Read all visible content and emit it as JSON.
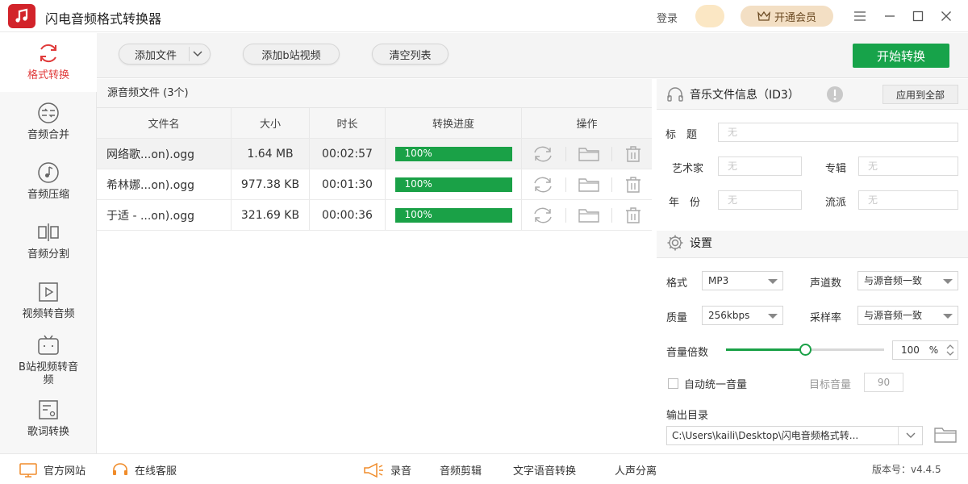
{
  "app": {
    "title": "闪电音频格式转换器",
    "login": "登录",
    "vip": "开通会员",
    "brand_color": "#d2232a",
    "accent_green": "#17a34a"
  },
  "sidebar": {
    "items": [
      {
        "label": "格式转换",
        "icon": "refresh-cycle-icon",
        "active": true
      },
      {
        "label": "音频合并",
        "icon": "merge-arrows-icon"
      },
      {
        "label": "音频压缩",
        "icon": "music-note-icon"
      },
      {
        "label": "音频分割",
        "icon": "split-icon"
      },
      {
        "label": "视频转音频",
        "icon": "video-play-icon"
      },
      {
        "label": "B站视频转音频",
        "icon": "bilibili-icon"
      },
      {
        "label": "歌词转换",
        "icon": "lyrics-file-icon"
      }
    ]
  },
  "toolbar": {
    "add_file": "添加文件",
    "add_bilibili": "添加b站视频",
    "clear_list": "清空列表",
    "start": "开始转换"
  },
  "files": {
    "header": "源音频文件 (3个)",
    "columns": [
      "文件名",
      "大小",
      "时长",
      "转换进度",
      "操作"
    ],
    "rows": [
      {
        "name": "网络歌...on).ogg",
        "size": "1.64 MB",
        "duration": "00:02:57",
        "progress": "100%",
        "progress_value": 1.0
      },
      {
        "name": "希林娜...on).ogg",
        "size": "977.38 KB",
        "duration": "00:01:30",
        "progress": "100%",
        "progress_value": 1.0
      },
      {
        "name": "于适 - ...on).ogg",
        "size": "321.69 KB",
        "duration": "00:00:36",
        "progress": "100%",
        "progress_value": 1.0
      }
    ]
  },
  "id3": {
    "title": "音乐文件信息（ID3）",
    "apply_all": "应用到全部",
    "fields": {
      "title_label": "标　题",
      "artist_label": "艺术家",
      "album_label": "专辑",
      "year_label": "年　份",
      "genre_label": "流派",
      "placeholder": "无"
    }
  },
  "settings": {
    "title": "设置",
    "format_label": "格式",
    "format_value": "MP3",
    "channels_label": "声道数",
    "channels_value": "与源音频一致",
    "quality_label": "质量",
    "quality_value": "256kbps",
    "samplerate_label": "采样率",
    "samplerate_value": "与源音频一致",
    "volume_label": "音量倍数",
    "volume_value": "100",
    "volume_unit": "%",
    "volume_slider_fraction": 0.5,
    "auto_volume_label": "自动统一音量",
    "target_volume_label": "目标音量",
    "target_volume_value": "90",
    "output_dir_label": "输出目录",
    "output_dir_value": "C:\\Users\\kaili\\Desktop\\闪电音频格式转..."
  },
  "footer": {
    "website": "官方网站",
    "support": "在线客服",
    "record": "录音",
    "edit": "音频剪辑",
    "tts": "文字语音转换",
    "vocal_split": "人声分离",
    "version": "版本号：v4.4.5"
  }
}
